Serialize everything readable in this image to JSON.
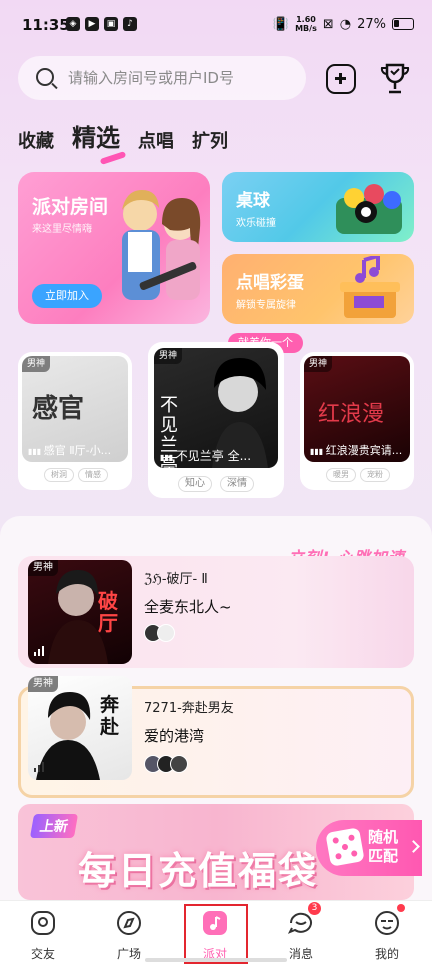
{
  "status_bar": {
    "time": "11:35",
    "net_speed_value": "1.60",
    "net_speed_unit": "MB/s",
    "battery": "27%"
  },
  "search": {
    "placeholder": "请输入房间号或用户ID号"
  },
  "tabs": [
    {
      "label": "收藏",
      "active": false
    },
    {
      "label": "精选",
      "active": true
    },
    {
      "label": "点唱",
      "active": false
    },
    {
      "label": "扩列",
      "active": false
    }
  ],
  "feature_cards": {
    "party": {
      "title": "派对房间",
      "subtitle": "来这里尽情嗨",
      "button": "立即加入"
    },
    "billiards": {
      "title": "桌球",
      "subtitle": "欢乐碰撞"
    },
    "song": {
      "title": "点唱彩蛋",
      "subtitle": "解锁专属旋律"
    }
  },
  "hint": "就差你一个",
  "rooms": [
    {
      "tag": "男神",
      "name": "感官 Ⅱ厅-小...",
      "chips": [
        "树洞",
        "情感"
      ],
      "art_text": "感官"
    },
    {
      "tag": "男神",
      "name": "不见兰亭 全...",
      "chips": [
        "知心",
        "深情"
      ],
      "art_text": "不见兰亭"
    },
    {
      "tag": "男神",
      "name": "红浪漫贵宾请...",
      "chips": [
        "暖男",
        "宠粉"
      ],
      "art_text": "红浪漫"
    }
  ],
  "slogan": "立刻! 心跳加速",
  "list": [
    {
      "tag": "男神",
      "id": "ℨℌ-破厅- Ⅱ",
      "name": "全麦东北人~",
      "art_text": "破厅",
      "avatars": 2
    },
    {
      "tag": "男神",
      "id": "7271-奔赴男友",
      "name": "爱的港湾",
      "art_text": "奔赴",
      "avatars": 3
    }
  ],
  "banner": {
    "new_tag": "上新",
    "title": "每日充值福袋"
  },
  "random_match": {
    "line1": "随机",
    "line2": "匹配"
  },
  "nav": [
    {
      "label": "交友",
      "icon": "friends-icon"
    },
    {
      "label": "广场",
      "icon": "compass-icon"
    },
    {
      "label": "派对",
      "icon": "party-music-icon",
      "active": true
    },
    {
      "label": "消息",
      "icon": "message-icon",
      "badge": "3"
    },
    {
      "label": "我的",
      "icon": "profile-icon",
      "dot": true
    }
  ],
  "colors": {
    "accent": "#ff5fb0",
    "join_button": "#3aa4ff",
    "highlight_box": "#e3262f"
  }
}
